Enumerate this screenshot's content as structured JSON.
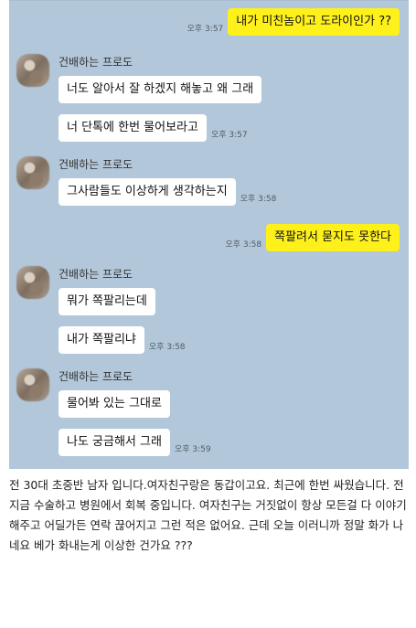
{
  "chat": {
    "messages": [
      {
        "from": "me",
        "text": "내가 미친놈이고 도라이인가 ??",
        "time": "오후 3:57"
      },
      {
        "from": "other",
        "sender": "건배하는 프로도",
        "bubbles": [
          {
            "text": "너도 알아서 잘 하겠지 해놓고 왜 그래",
            "time": ""
          },
          {
            "text": "너 단톡에 한번 물어보라고",
            "time": "오후 3:57"
          }
        ]
      },
      {
        "from": "other",
        "sender": "건배하는 프로도",
        "bubbles": [
          {
            "text": "그사람들도 이상하게 생각하는지",
            "time": "오후 3:58"
          }
        ]
      },
      {
        "from": "me",
        "text": "쪽팔려서 묻지도 못한다",
        "time": "오후 3:58"
      },
      {
        "from": "other",
        "sender": "건배하는 프로도",
        "bubbles": [
          {
            "text": "뭐가 쪽팔리는데",
            "time": ""
          },
          {
            "text": "내가 쪽팔리냐",
            "time": "오후 3:58"
          }
        ]
      },
      {
        "from": "other",
        "sender": "건배하는 프로도",
        "bubbles": [
          {
            "text": "물어봐 있는 그대로",
            "time": ""
          },
          {
            "text": "나도 궁금해서 그래",
            "time": "오후 3:59"
          }
        ]
      }
    ]
  },
  "post": {
    "text": "전 30대 초중반 남자 입니다.여자친구랑은 동갑이고요. 최근에 한번 싸웠습니다. 전 지금 수술하고 병원에서 회복 중입니다. 여자친구는 거짓없이 항상 모든걸 다 이야기 해주고 어딜가든 연락 끊어지고 그런 적은 없어요. 근데 오늘 이러니까 정말 화가 나네요 베가 화내는게 이상한 건가요 ???"
  }
}
